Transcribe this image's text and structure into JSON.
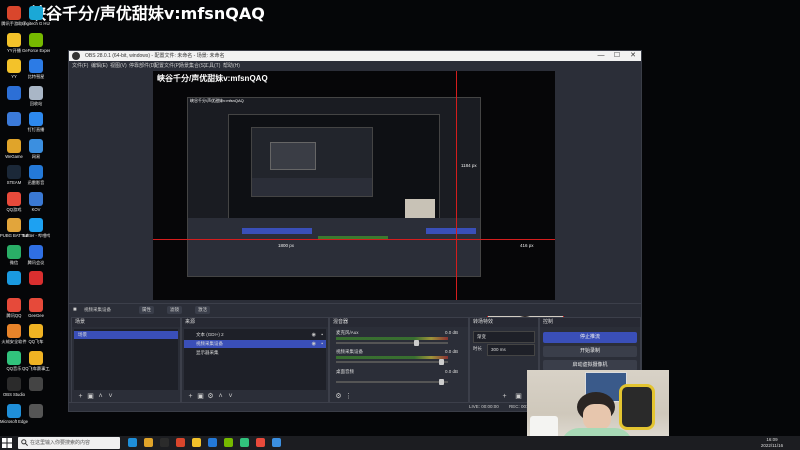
{
  "overlay": {
    "stream_title": "峡谷千分/声优甜妹v:mfsnQAQ"
  },
  "desktop_icons": [
    {
      "label": "腾讯手游助手",
      "color": "#d9462c"
    },
    {
      "label": "Logitech G HUB",
      "color": "#1ba8d6"
    },
    {
      "label": "YY开播",
      "color": "#f3c22a"
    },
    {
      "label": "GeForce Experience",
      "color": "#76b900"
    },
    {
      "label": "YY",
      "color": "#f3c22a"
    },
    {
      "label": "比特彗星",
      "color": "#2c7be5"
    },
    {
      "label": "",
      "color": "#2c6fd6"
    },
    {
      "label": "回收站",
      "color": "#a9b6c6"
    },
    {
      "label": "",
      "color": "#3b7ad9"
    },
    {
      "label": "钉钉直播",
      "color": "#2d89ef"
    },
    {
      "label": "WeGame",
      "color": "#e0a42a"
    },
    {
      "label": "网易",
      "color": "#3b8fe0"
    },
    {
      "label": "STEAM",
      "color": "#1b2838"
    },
    {
      "label": "迅雷影音",
      "color": "#2479d8"
    },
    {
      "label": "QQ游戏",
      "color": "#e84a3b"
    },
    {
      "label": "KOV",
      "color": "#3a79d4"
    },
    {
      "label": "PUBG BATTLEGR...",
      "color": "#e2a53b"
    },
    {
      "label": "Twitter - 哔哩哔哩",
      "color": "#1da1f2"
    },
    {
      "label": "微信",
      "color": "#2aae67"
    },
    {
      "label": "腾讯会议",
      "color": "#2f6fe3"
    },
    {
      "label": "",
      "color": "#1a9ae0"
    },
    {
      "label": "",
      "color": "#d92f2f"
    },
    {
      "label": "腾讯QQ",
      "color": "#e64a3a"
    },
    {
      "label": "GeeGee",
      "color": "#e64a3a"
    },
    {
      "label": "火绒安全软件",
      "color": "#e8842a"
    },
    {
      "label": "QQ飞车",
      "color": "#f0b323"
    },
    {
      "label": "QQ音乐",
      "color": "#31c27c"
    },
    {
      "label": "QQ飞车赛事工具",
      "color": "#f0b323"
    },
    {
      "label": "OBS Studio",
      "color": "#2b2b2b"
    },
    {
      "label": "",
      "color": "#444"
    },
    {
      "label": "Microsoft Edge",
      "color": "#1f8fd9"
    },
    {
      "label": "",
      "color": "#555"
    }
  ],
  "obs": {
    "title": "OBS 28.0.1 (64-bit, windows) - 配置文件: 未命名 - 场景: 未命名",
    "menu": [
      "文件(F)",
      "编辑(E)",
      "视图(V)",
      "停靠部件(D)",
      "配置文件(P)",
      "场景集合(S)",
      "工具(T)",
      "帮助(H)"
    ],
    "window_controls": {
      "minimize": "—",
      "maximize": "☐",
      "close": "✕"
    },
    "guides": {
      "top": "1184 px",
      "left": "1800 px",
      "right": "416 px"
    },
    "source_bar": {
      "scene": "视频采集设备",
      "properties": "属性",
      "filters": "滤镜",
      "device": "激活"
    },
    "scenes": {
      "header": "场景",
      "items": [
        "场景"
      ]
    },
    "sources": {
      "header": "来源",
      "items": [
        {
          "name": "文本 (GDI+) 2",
          "selected": false
        },
        {
          "name": "视频采集设备",
          "selected": true
        },
        {
          "name": "显示器采集",
          "selected": false
        }
      ]
    },
    "mixer": {
      "header": "混音器",
      "channels": [
        {
          "name": "麦克风/Aux",
          "db": "0.0 dB",
          "level": 0.68
        },
        {
          "name": "视频采集设备",
          "db": "0.0 dB",
          "level": 0.82
        },
        {
          "name": "桌面音频",
          "db": "0.0 dB",
          "level": 0.0
        }
      ]
    },
    "transitions": {
      "header": "转场特效",
      "type": "渐变",
      "duration_label": "时长",
      "duration": "300 ms"
    },
    "controls": {
      "header": "控制",
      "buttons": [
        "停止推流",
        "开始录制",
        "启动虚拟摄像机"
      ]
    },
    "status": {
      "live": "LIVE: 00:00:00",
      "rec": "REC: 00:00:00",
      "cpu": "CPU: 2.0%, 30.00 fps"
    }
  },
  "taskbar": {
    "search_placeholder": "在这里输入你要搜索的内容",
    "time": "16:09",
    "date": "2022/11/16",
    "apps": [
      "#1f8fd9",
      "#e0a42a",
      "#2b2b2b",
      "#d9462c",
      "#f3c22a",
      "#2479d8",
      "#76b900",
      "#31c27c",
      "#e84a3b",
      "#3b8fe0"
    ]
  }
}
